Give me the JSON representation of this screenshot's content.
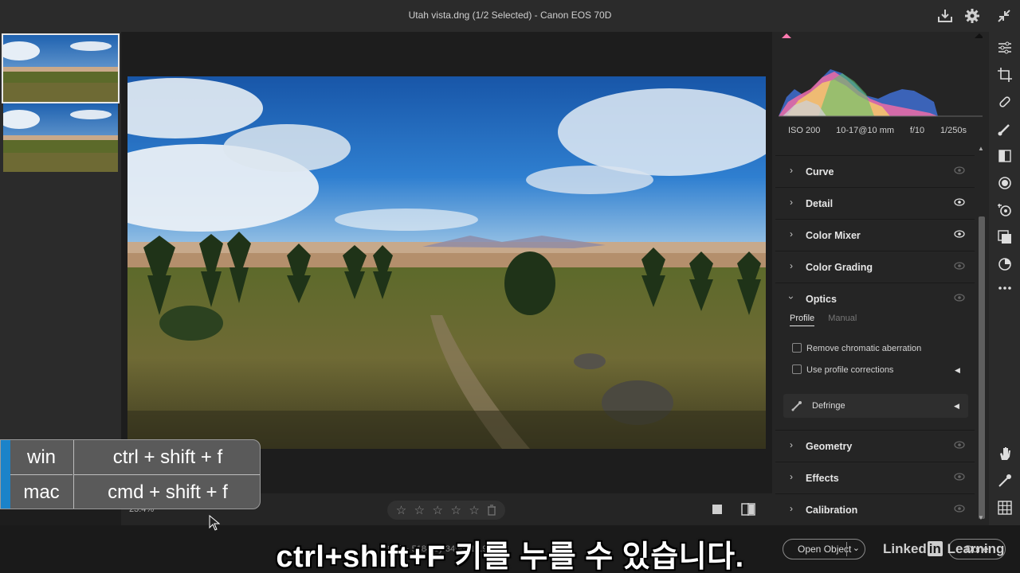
{
  "window": {
    "title": "Utah vista.dng (1/2 Selected)  -  Canon EOS 70D"
  },
  "toolbar": {
    "zoom": "23.4%"
  },
  "panel": {
    "exif": {
      "iso": "ISO 200",
      "lens": "10-17@10 mm",
      "aperture": "f/10",
      "shutter": "1/250s"
    },
    "sections": {
      "curve": "Curve",
      "detail": "Detail",
      "color_mixer": "Color Mixer",
      "color_grading": "Color Grading",
      "optics": "Optics",
      "geometry": "Geometry",
      "effects": "Effects",
      "calibration": "Calibration"
    },
    "optics": {
      "tabs": [
        "Profile",
        "Manual"
      ],
      "remove_ca": "Remove chromatic aberration",
      "profile_corrections": "Use profile corrections",
      "defringe": "Defringe"
    }
  },
  "footer": {
    "info": "98 bit · 5184 by 3456 (17.9MP)",
    "open_button": "Open Object",
    "done_button": "Done",
    "brand_a": "Linked",
    "brand_in": "in",
    "brand_b": " Learning"
  },
  "shortcut": {
    "win_label": "win",
    "win_keys": "ctrl + shift + f",
    "mac_label": "mac",
    "mac_keys": "cmd + shift + f"
  },
  "subtitle": "ctrl+shift+F 키를 누를 수 있습니다."
}
